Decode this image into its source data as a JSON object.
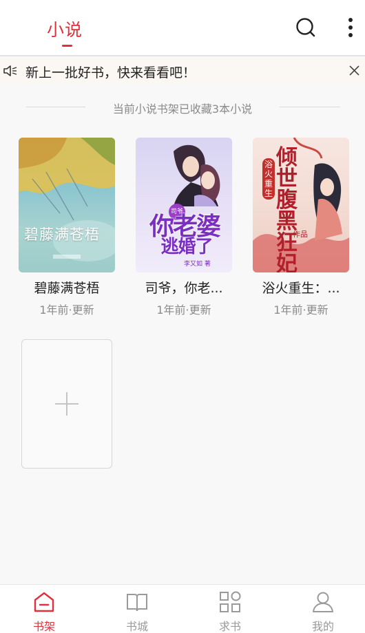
{
  "header": {
    "title": "小说",
    "accent_color": "#e0303c"
  },
  "notice": {
    "text": "新上一批好书，快来看看吧！",
    "icon": "speaker-icon"
  },
  "shelf": {
    "summary": "当前小说书架已收藏3本小说",
    "books": [
      {
        "title": "碧藤满苍梧",
        "updated": "1年前·更新",
        "cover_text": "碧藤满苍梧"
      },
      {
        "title": "司爷，你老...",
        "updated": "1年前·更新",
        "cover_text_top": "司爷",
        "cover_text_main": "你老婆",
        "cover_text_sub": "逃婚了",
        "cover_author": "李又如 著"
      },
      {
        "title": "浴火重生：...",
        "updated": "1年前·更新",
        "cover_text_top": "浴火重生",
        "cover_text_main": "倾世腹黑狂妃",
        "cover_text_sub": "作品"
      }
    ],
    "add_icon": "plus-icon"
  },
  "bottom_nav": {
    "items": [
      {
        "label": "书架",
        "icon": "bookshelf-icon",
        "active": true
      },
      {
        "label": "书城",
        "icon": "book-icon",
        "active": false
      },
      {
        "label": "求书",
        "icon": "grid-icon",
        "active": false
      },
      {
        "label": "我的",
        "icon": "user-icon",
        "active": false
      }
    ],
    "active_color": "#e0303c",
    "inactive_color": "#9a9a9a"
  }
}
